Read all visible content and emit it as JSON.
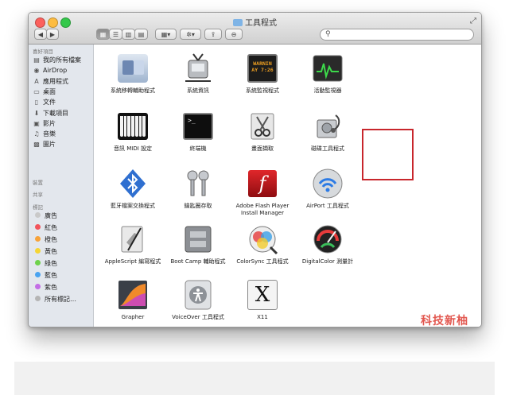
{
  "window": {
    "title": "工具程式"
  },
  "toolbar": {
    "back": "◀",
    "forward": "▶",
    "view_icon": "▦",
    "view_list": "☰",
    "view_column": "▥",
    "view_coverflow": "▤",
    "arrange": "▦▾",
    "action": "✲▾",
    "share": "⇪",
    "tags": "⊖",
    "search_placeholder": ""
  },
  "sidebar": {
    "favorites_header": "喜好項目",
    "favorites": [
      {
        "label": "我的所有檔案",
        "icon": "all-files-icon",
        "glyph": "▤"
      },
      {
        "label": "AirDrop",
        "icon": "airdrop-icon",
        "glyph": "◉"
      },
      {
        "label": "應用程式",
        "icon": "applications-icon",
        "glyph": "A"
      },
      {
        "label": "桌面",
        "icon": "desktop-icon",
        "glyph": "▭"
      },
      {
        "label": "文件",
        "icon": "documents-icon",
        "glyph": "▯"
      },
      {
        "label": "下載項目",
        "icon": "downloads-icon",
        "glyph": "⬇"
      },
      {
        "label": "影片",
        "icon": "movies-icon",
        "glyph": "▣"
      },
      {
        "label": "音樂",
        "icon": "music-icon",
        "glyph": "♫"
      },
      {
        "label": "圖片",
        "icon": "pictures-icon",
        "glyph": "▩"
      }
    ],
    "devices_header": "裝置",
    "shared_header": "共享",
    "tags_header": "標記",
    "tags": [
      {
        "label": "廣告",
        "color": "#c9c9c9"
      },
      {
        "label": "紅色",
        "color": "#f2545b"
      },
      {
        "label": "橙色",
        "color": "#f7a33a"
      },
      {
        "label": "黃色",
        "color": "#f5d535"
      },
      {
        "label": "綠色",
        "color": "#6ed24b"
      },
      {
        "label": "藍色",
        "color": "#4aa3f0"
      },
      {
        "label": "紫色",
        "color": "#c36ee6"
      },
      {
        "label": "所有標記…",
        "color": "#b5b5b5"
      }
    ]
  },
  "apps": [
    {
      "label": "系統移轉輔助程式",
      "icon": "migration-assistant-icon"
    },
    {
      "label": "系統資訊",
      "icon": "system-information-icon"
    },
    {
      "label": "系統監視程式",
      "icon": "console-icon",
      "screen_text": "WARNIN AY 7:26"
    },
    {
      "label": "活動監視器",
      "icon": "activity-monitor-icon"
    },
    {
      "label": "音訊 MIDI 設定",
      "icon": "audio-midi-setup-icon"
    },
    {
      "label": "終端機",
      "icon": "terminal-icon",
      "screen_text": ">_"
    },
    {
      "label": "畫面擷取",
      "icon": "grab-icon"
    },
    {
      "label": "磁碟工具程式",
      "icon": "disk-utility-icon",
      "selected": true
    },
    {
      "label": "藍牙檔案交換程式",
      "icon": "bluetooth-file-exchange-icon"
    },
    {
      "label": "鑰匙圈存取",
      "icon": "keychain-access-icon"
    },
    {
      "label": "Adobe Flash Player Install Manager",
      "icon": "flash-player-icon",
      "logo_text": "f"
    },
    {
      "label": "AirPort 工具程式",
      "icon": "airport-utility-icon"
    },
    {
      "label": "AppleScript 編寫程式",
      "icon": "applescript-editor-icon"
    },
    {
      "label": "Boot Camp 輔助程式",
      "icon": "boot-camp-assistant-icon"
    },
    {
      "label": "ColorSync 工具程式",
      "icon": "colorsync-utility-icon"
    },
    {
      "label": "DigitalColor 測量計",
      "icon": "digitalcolor-meter-icon"
    },
    {
      "label": "Grapher",
      "icon": "grapher-icon"
    },
    {
      "label": "VoiceOver 工具程式",
      "icon": "voiceover-utility-icon"
    },
    {
      "label": "X11",
      "icon": "x11-icon",
      "logo_text": "X"
    }
  ],
  "watermark": "科技新柚",
  "colors": {
    "selection_border": "#c8262c",
    "watermark": "#e2574f",
    "sidebar_bg": "#e3e7ed"
  }
}
